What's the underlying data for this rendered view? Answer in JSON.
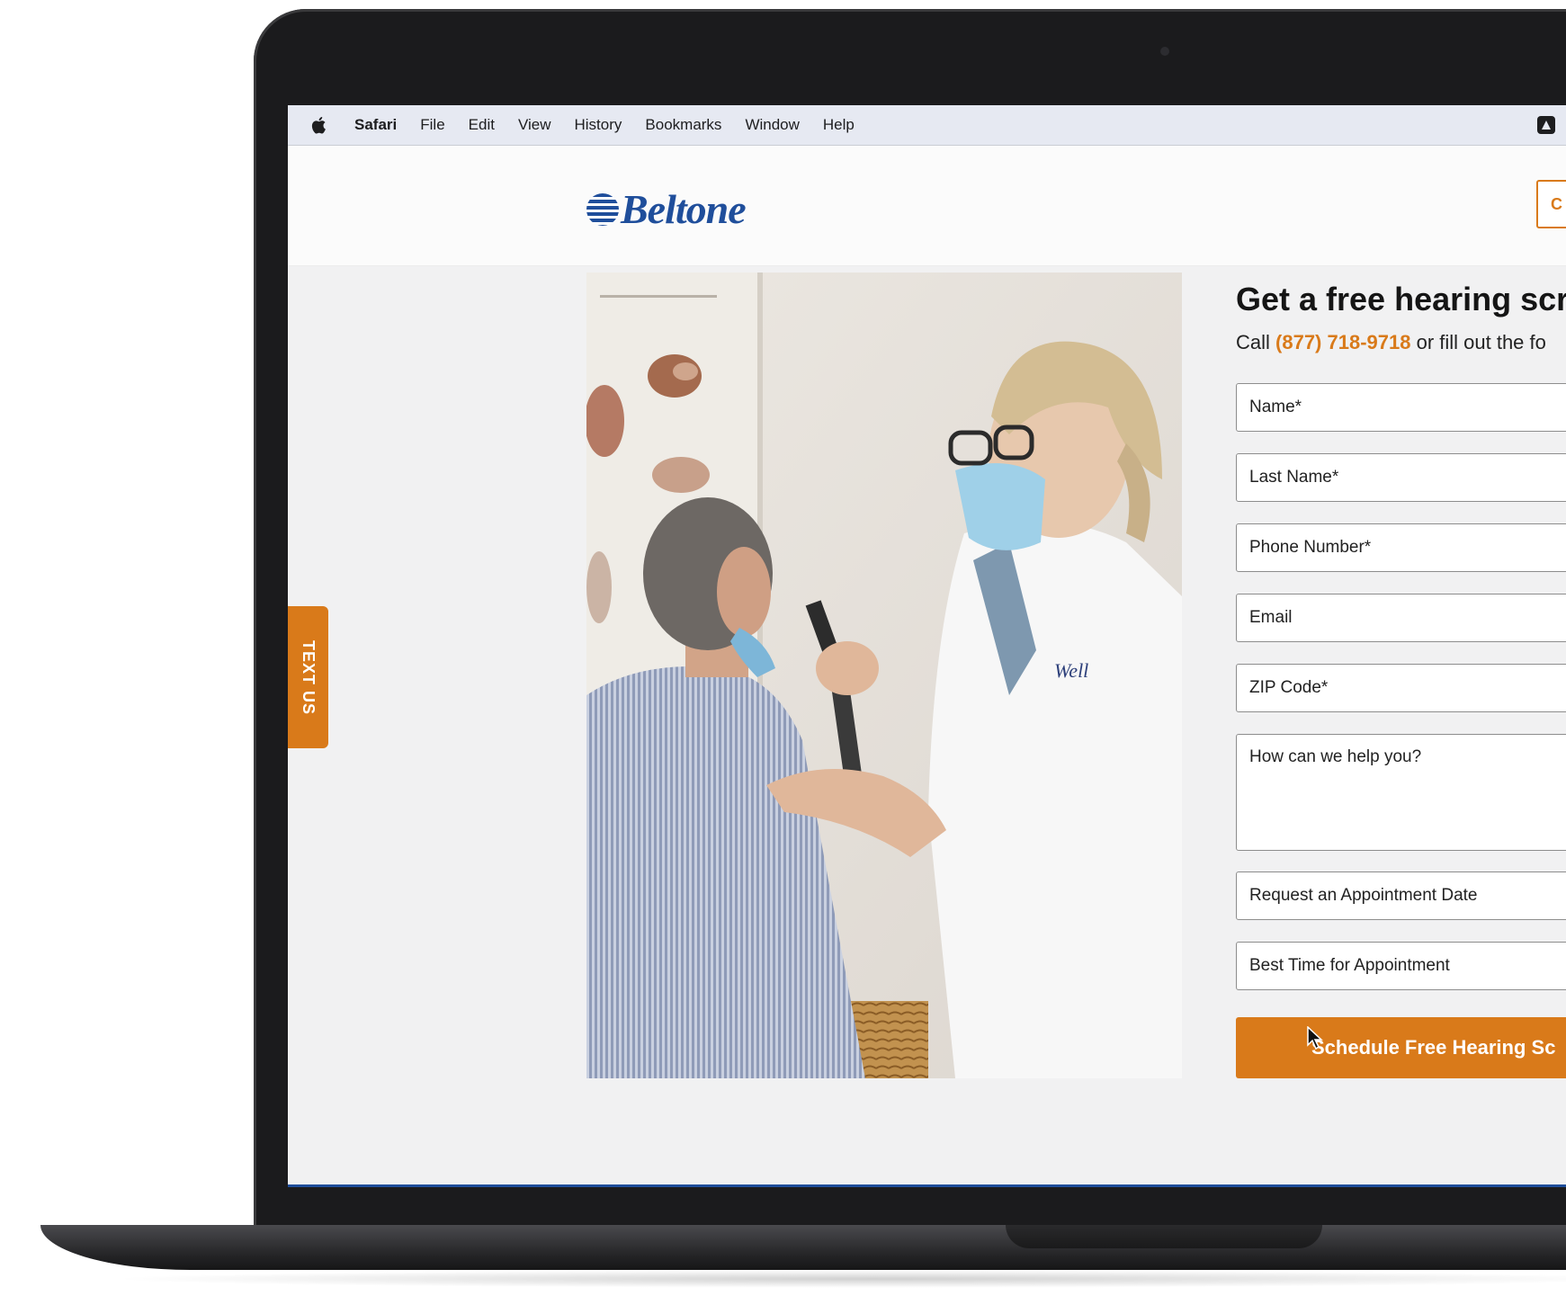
{
  "menubar": {
    "app_name": "Safari",
    "items": [
      "File",
      "Edit",
      "View",
      "History",
      "Bookmarks",
      "Window",
      "Help"
    ]
  },
  "header": {
    "logo_text": "Beltone",
    "cta_label": "C"
  },
  "text_us": {
    "label": "TEXT US"
  },
  "form": {
    "title": "Get a free hearing scr",
    "subtitle_prefix": "Call ",
    "phone": "(877) 718-9718",
    "subtitle_suffix": " or fill out the fo",
    "fields": {
      "name": "Name*",
      "last_name": "Last Name*",
      "phone_number": "Phone Number*",
      "email": "Email",
      "zip": "ZIP Code*",
      "message": "How can we help you?",
      "appointment_date": "Request an Appointment Date",
      "appointment_time": "Best Time for Appointment"
    },
    "submit_label": "Schedule Free Hearing Sc"
  },
  "colors": {
    "accent": "#d97a1a",
    "brand_blue": "#1f4e9b"
  }
}
